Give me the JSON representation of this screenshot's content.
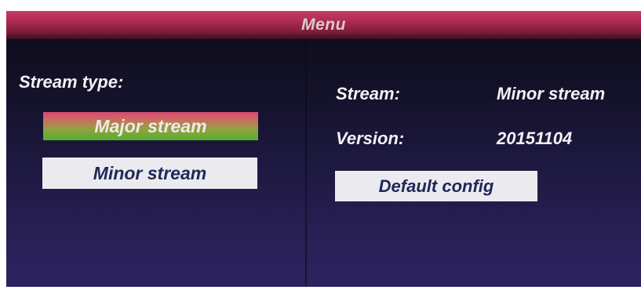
{
  "menu": {
    "title": "Menu"
  },
  "left": {
    "stream_type_label": "Stream type:",
    "major_stream_button": "Major stream",
    "minor_stream_button": "Minor stream"
  },
  "right": {
    "stream_label": "Stream:",
    "stream_value": "Minor stream",
    "version_label": "Version:",
    "version_value": "20151104",
    "default_config_button": "Default config"
  },
  "colors": {
    "title_bar": "#b02a52",
    "panel_background": "#1f1a44",
    "selected_button_gradient_top": "#d84a72",
    "selected_button_gradient_bottom": "#55b02c",
    "button_background": "#ebebef",
    "button_text": "#20285a"
  }
}
